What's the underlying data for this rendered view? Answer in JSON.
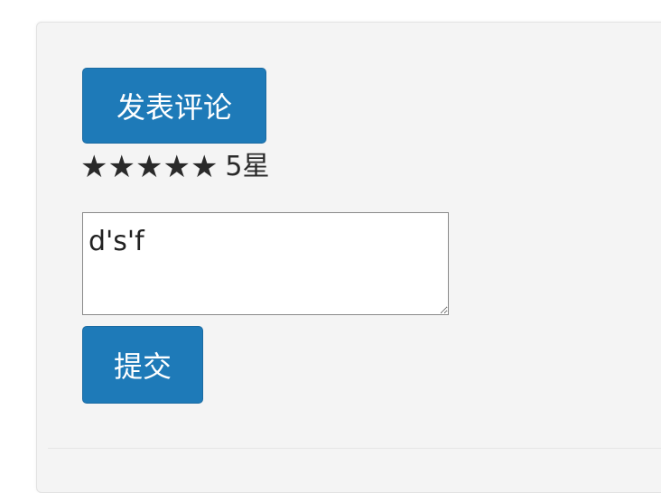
{
  "post_button": {
    "label": "发表评论"
  },
  "rating": {
    "stars": [
      "★",
      "★",
      "★",
      "★",
      "★"
    ],
    "value": 5,
    "label": "5星"
  },
  "comment": {
    "value": "d's'f"
  },
  "submit_button": {
    "label": "提交"
  },
  "colors": {
    "panel_background": "#f4f4f4",
    "button_background": "#1e7ab8",
    "button_text": "#ffffff"
  }
}
